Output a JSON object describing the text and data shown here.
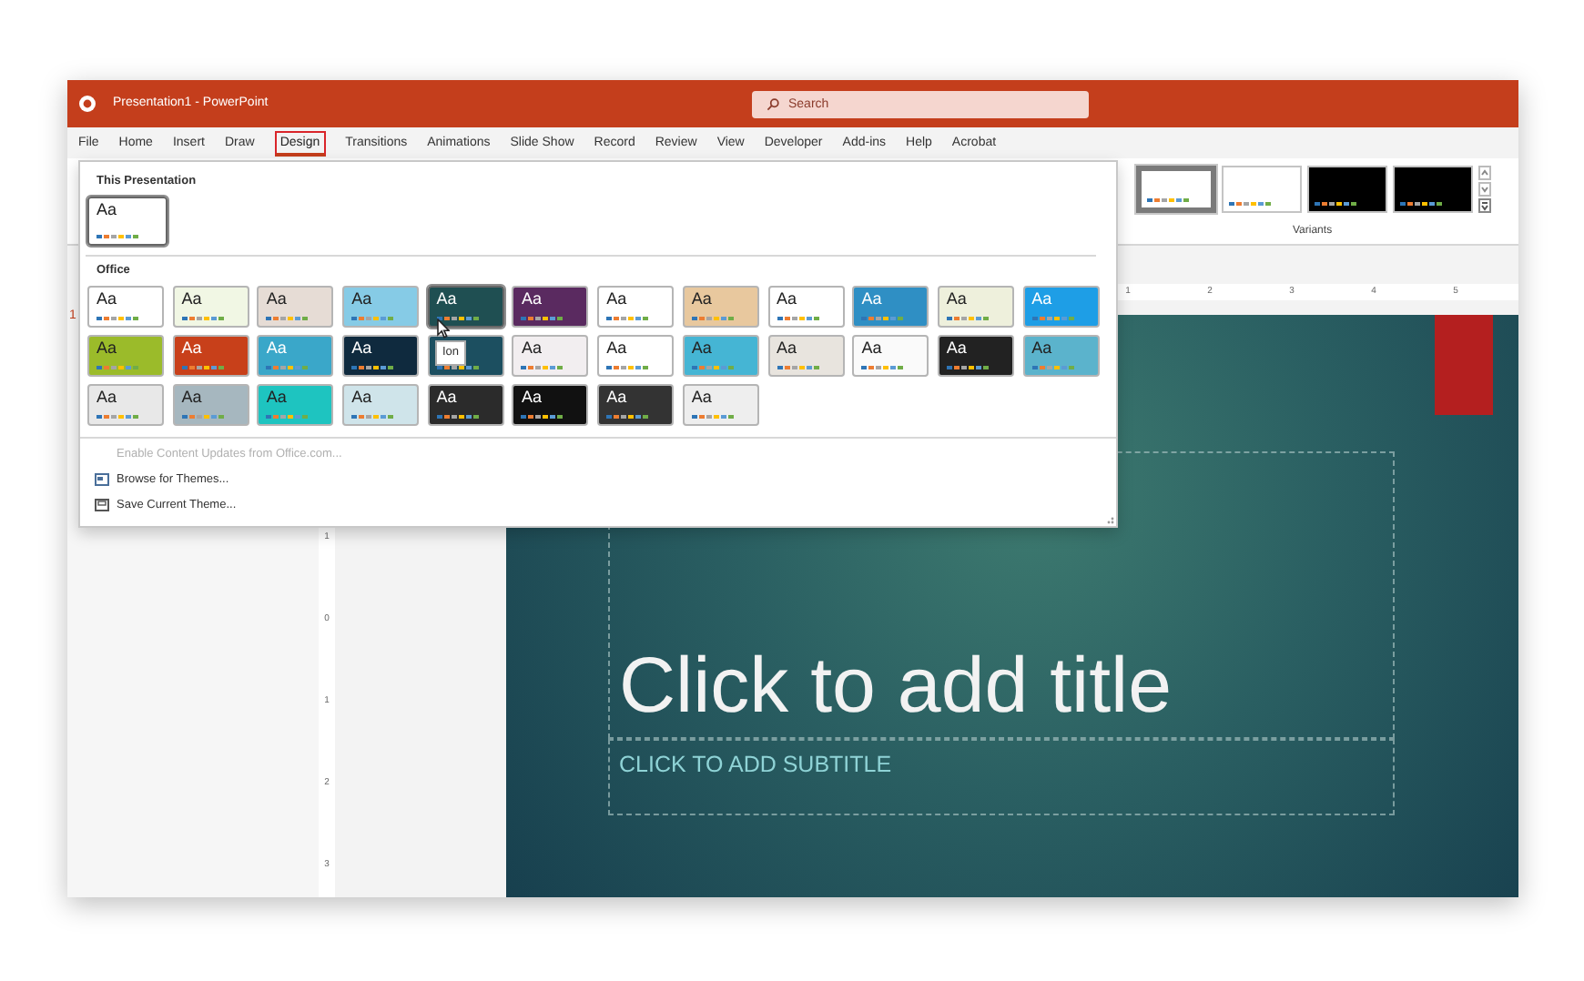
{
  "window": {
    "title": "Presentation1 - PowerPoint"
  },
  "search": {
    "placeholder": "Search"
  },
  "menu_tabs": [
    {
      "label": "File",
      "selected": false
    },
    {
      "label": "Home",
      "selected": false
    },
    {
      "label": "Insert",
      "selected": false
    },
    {
      "label": "Draw",
      "selected": false
    },
    {
      "label": "Design",
      "selected": true
    },
    {
      "label": "Transitions",
      "selected": false
    },
    {
      "label": "Animations",
      "selected": false
    },
    {
      "label": "Slide Show",
      "selected": false
    },
    {
      "label": "Record",
      "selected": false
    },
    {
      "label": "Review",
      "selected": false
    },
    {
      "label": "View",
      "selected": false
    },
    {
      "label": "Developer",
      "selected": false
    },
    {
      "label": "Add-ins",
      "selected": false
    },
    {
      "label": "Help",
      "selected": false
    },
    {
      "label": "Acrobat",
      "selected": false
    }
  ],
  "variants": {
    "label": "Variants",
    "items": [
      {
        "color": "#ffffff",
        "selected": true
      },
      {
        "color": "#ffffff",
        "selected": false
      },
      {
        "color": "#000000",
        "selected": false
      },
      {
        "color": "#000000",
        "selected": false
      }
    ]
  },
  "slide_pane": {
    "slide_number": "1"
  },
  "rulers": {
    "horizontal": [
      "1",
      "2",
      "3",
      "4",
      "5"
    ],
    "vertical": [
      "1",
      "0",
      "1",
      "2",
      "3"
    ]
  },
  "theme_gallery": {
    "current_heading": "This Presentation",
    "current_themes": [
      {
        "label": "Aa",
        "color": "#ffffff",
        "selected": true
      }
    ],
    "office_heading": "Office",
    "office_themes": [
      {
        "label": "Aa",
        "color": "#ffffff",
        "selected": false
      },
      {
        "label": "Aa",
        "color": "#f1f7e4",
        "selected": false
      },
      {
        "label": "Aa",
        "color": "#e6dcd5",
        "selected": false
      },
      {
        "label": "Aa",
        "color": "#86cbe6",
        "selected": false
      },
      {
        "label": "Aa",
        "color": "#1f4f52",
        "selected": true
      },
      {
        "label": "Aa",
        "color": "#5a2a60",
        "selected": false
      },
      {
        "label": "Aa",
        "color": "#ffffff",
        "selected": false
      },
      {
        "label": "Aa",
        "color": "#e8c89e",
        "selected": false
      },
      {
        "label": "Aa",
        "color": "#ffffff",
        "selected": false
      },
      {
        "label": "Aa",
        "color": "#2f8fc4",
        "selected": false
      },
      {
        "label": "Aa",
        "color": "#eef0dc",
        "selected": false
      },
      {
        "label": "Aa",
        "color": "#1e9ee6",
        "selected": false
      },
      {
        "label": "Aa",
        "color": "#9bbb2a",
        "selected": false
      },
      {
        "label": "Aa",
        "color": "#c8401a",
        "selected": false
      },
      {
        "label": "Aa",
        "color": "#3aa7c9",
        "selected": false
      },
      {
        "label": "Aa",
        "color": "#0f2a3e",
        "selected": false
      },
      {
        "color": "#1c4f60",
        "selected": false
      },
      {
        "label": "Aa",
        "color": "#f2eef0",
        "selected": false
      },
      {
        "label": "Aa",
        "color": "#ffffff",
        "selected": false
      },
      {
        "label": "Aa",
        "color": "#45b5d4",
        "selected": false
      },
      {
        "label": "Aa",
        "color": "#e8e4de",
        "selected": false
      },
      {
        "label": "Aa",
        "color": "#fafafa",
        "selected": false
      },
      {
        "label": "Aa",
        "color": "#222222",
        "selected": false
      },
      {
        "label": "Aa",
        "color": "#5bb3cc",
        "selected": false
      },
      {
        "label": "Aa",
        "color": "#e8e8e8",
        "selected": false
      },
      {
        "label": "Aa",
        "color": "#a6b7bf",
        "selected": false
      },
      {
        "label": "Aa",
        "color": "#1ec4c0",
        "selected": false
      },
      {
        "label": "Aa",
        "color": "#cfe4ea",
        "selected": false
      },
      {
        "label": "Aa",
        "color": "#2b2b2b",
        "selected": false
      },
      {
        "label": "Aa",
        "color": "#111111",
        "selected": false
      },
      {
        "label": "Aa",
        "color": "#333333",
        "selected": false
      },
      {
        "label": "Aa",
        "color": "#eeeeee",
        "selected": false
      }
    ],
    "tooltip": "Ion",
    "commands": [
      {
        "label": "Enable Content Updates from Office.com...",
        "disabled": true,
        "kind": "plain"
      },
      {
        "label": "Browse for Themes...",
        "disabled": false,
        "kind": "browse"
      },
      {
        "label": "Save Current Theme...",
        "disabled": false,
        "kind": "save"
      }
    ]
  },
  "slide": {
    "title_placeholder": "Click to add title",
    "subtitle_placeholder": "CLICK TO ADD SUBTITLE"
  }
}
